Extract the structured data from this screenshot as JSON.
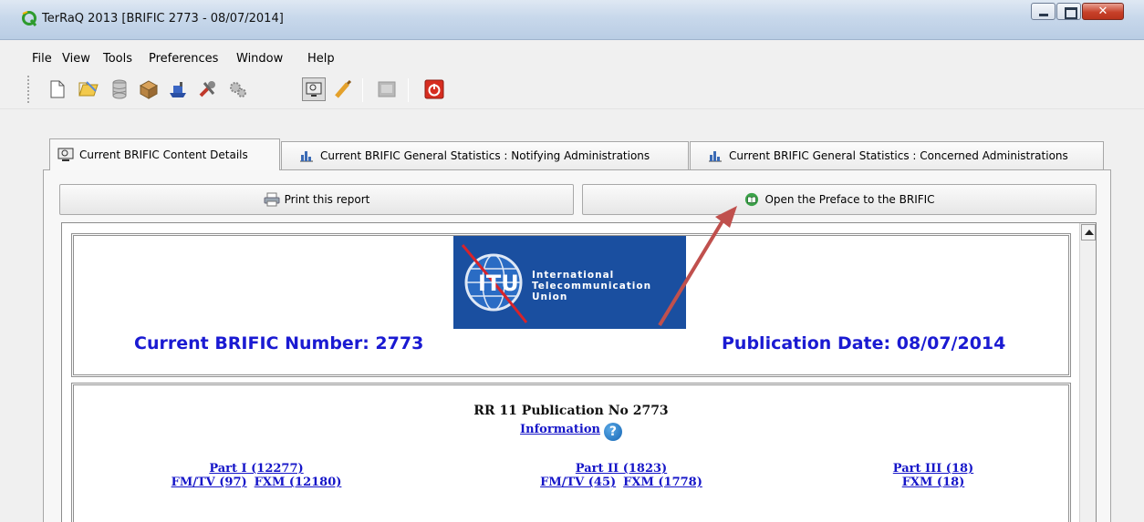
{
  "window": {
    "title": "TerRaQ 2013 [BRIFIC 2773 - 08/07/2014]"
  },
  "menu": [
    "File",
    "View",
    "Tools",
    "Preferences",
    "Window",
    "Help"
  ],
  "toolbar_icons": [
    "new-file-icon",
    "open-folder-icon",
    "database-icon",
    "package-icon",
    "ship-icon",
    "tools-icon",
    "gears-icon",
    "monitor-icon",
    "brush-icon",
    "image-icon",
    "power-icon"
  ],
  "tabs": [
    {
      "label": "Current BRIFIC Content Details"
    },
    {
      "label": "Current BRIFIC General Statistics : Notifying Administrations"
    },
    {
      "label": "Current BRIFIC General Statistics : Concerned Administrations"
    }
  ],
  "buttons": {
    "print": "Print this report",
    "preface": "Open the Preface to the BRIFIC"
  },
  "header": {
    "number": "Current BRIFIC Number: 2773",
    "date": "Publication Date: 08/07/2014",
    "logo": {
      "abbr": "ITU",
      "line1": "International",
      "line2": "Telecommunication",
      "line3": "Union"
    }
  },
  "publication": {
    "title": "RR 11 Publication No 2773",
    "info_link": "Information",
    "parts": [
      {
        "title": "Part I (12277)",
        "fm_tv": "FM/TV (97)",
        "fxm": "FXM (12180)"
      },
      {
        "title": "Part II (1823)",
        "fm_tv": "FM/TV (45)",
        "fxm": "FXM (1778)"
      },
      {
        "title": "Part III (18)",
        "fxm": "FXM (18)"
      }
    ]
  },
  "colors": {
    "link": "#1515c8",
    "heading": "#1a1ad2",
    "logo_bg": "#1a4fa0",
    "annotation_arrow": "#c0504d"
  }
}
